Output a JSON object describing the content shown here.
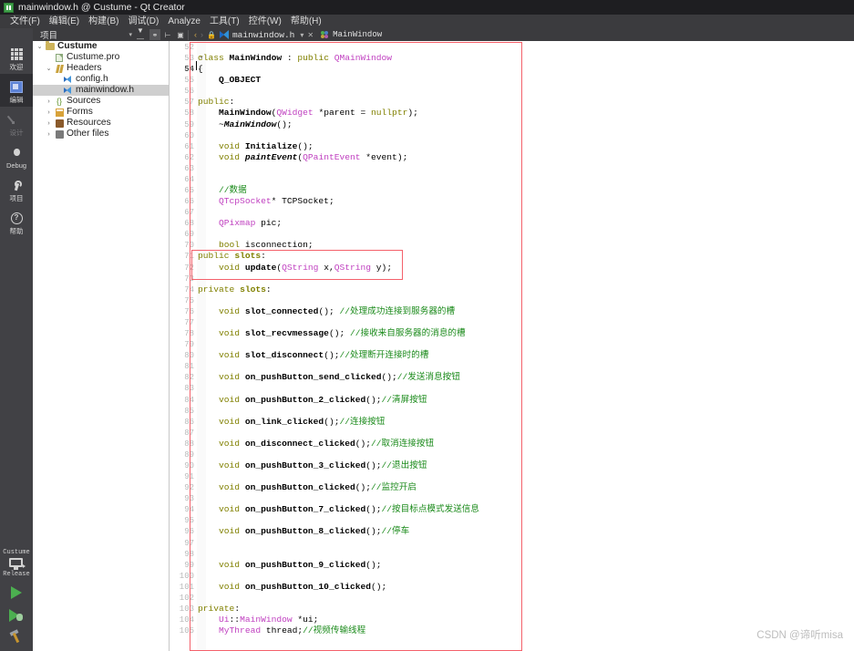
{
  "window": {
    "title": "mainwindow.h @ Custume - Qt Creator",
    "app_icon": "qt-creator-icon"
  },
  "menubar": {
    "items": [
      {
        "label": "文件(F)",
        "name": "menu-file"
      },
      {
        "label": "编辑(E)",
        "name": "menu-edit"
      },
      {
        "label": "构建(B)",
        "name": "menu-build"
      },
      {
        "label": "调试(D)",
        "name": "menu-debug"
      },
      {
        "label": "Analyze",
        "name": "menu-analyze"
      },
      {
        "label": "工具(T)",
        "name": "menu-tools"
      },
      {
        "label": "控件(W)",
        "name": "menu-window"
      },
      {
        "label": "帮助(H)",
        "name": "menu-help"
      }
    ]
  },
  "toolbar": {
    "tree_selector": "项目",
    "tree_selector_caret": "▾",
    "filter_icon": "filter-icon",
    "sync_icon": "link-sync-icon",
    "expand_icon": "expand-all-icon",
    "split_icon": "split-view-icon",
    "nav_back": "‹",
    "nav_forward": "›",
    "lock_icon": "lock-icon",
    "document_name": "mainwindow.h",
    "document_caret": "▾",
    "document_close": "✕",
    "symbol_name": "MainWindow"
  },
  "modebar": {
    "items": [
      {
        "label": "欢迎",
        "icon": "welcome-grid-icon",
        "state": "normal",
        "name": "mode-welcome"
      },
      {
        "label": "编辑",
        "icon": "edit-icon",
        "state": "selected",
        "name": "mode-edit"
      },
      {
        "label": "设计",
        "icon": "design-pencil-icon",
        "state": "disabled",
        "name": "mode-design"
      },
      {
        "label": "Debug",
        "icon": "debug-bug-icon",
        "state": "normal",
        "name": "mode-debug"
      },
      {
        "label": "项目",
        "icon": "projects-wrench-icon",
        "state": "normal",
        "name": "mode-projects"
      },
      {
        "label": "帮助",
        "icon": "help-question-icon",
        "state": "normal",
        "name": "mode-help"
      }
    ],
    "kit_name": "Custume",
    "build_config": "Release",
    "run_icon": "run-triangle-icon",
    "debug_icon": "debug-run-icon",
    "build_icon": "build-hammer-icon"
  },
  "project_tree": {
    "rows": [
      {
        "label": "Custume",
        "indent": 0,
        "twisty": "⌄",
        "icon": "folder-icon",
        "bold": true,
        "selected": false
      },
      {
        "label": "Custume.pro",
        "indent": 1,
        "twisty": "",
        "icon": "pro-file-icon",
        "bold": false,
        "selected": false
      },
      {
        "label": "Headers",
        "indent": 1,
        "twisty": "⌄",
        "icon": "headers-icon",
        "bold": false,
        "selected": false
      },
      {
        "label": "config.h",
        "indent": 2,
        "twisty": "",
        "icon": "header-file-icon",
        "bold": false,
        "selected": false
      },
      {
        "label": "mainwindow.h",
        "indent": 2,
        "twisty": "",
        "icon": "header-file-icon",
        "bold": false,
        "selected": true
      },
      {
        "label": "Sources",
        "indent": 1,
        "twisty": "›",
        "icon": "sources-icon",
        "bold": false,
        "selected": false
      },
      {
        "label": "Forms",
        "indent": 1,
        "twisty": "›",
        "icon": "forms-icon",
        "bold": false,
        "selected": false
      },
      {
        "label": "Resources",
        "indent": 1,
        "twisty": "›",
        "icon": "resources-icon",
        "bold": false,
        "selected": false
      },
      {
        "label": "Other files",
        "indent": 1,
        "twisty": "›",
        "icon": "other-files-icon",
        "bold": false,
        "selected": false
      }
    ]
  },
  "editor": {
    "first_line_number": 52,
    "current_line_number": 54,
    "total_visible_lines": 54,
    "lines": [
      {
        "n": 52,
        "fold": "",
        "tokens": []
      },
      {
        "n": 53,
        "fold": "▾",
        "tokens": [
          {
            "t": "class ",
            "c": "k"
          },
          {
            "t": "MainWindow",
            "c": "fn"
          },
          {
            "t": " : ",
            "c": "pl"
          },
          {
            "t": "public",
            "c": "k"
          },
          {
            "t": " ",
            "c": "pl"
          },
          {
            "t": "QMainWindow",
            "c": "ty"
          }
        ]
      },
      {
        "n": 54,
        "fold": "·",
        "tokens": [
          {
            "t": "{",
            "c": "pl"
          }
        ]
      },
      {
        "n": 55,
        "fold": "",
        "tokens": [
          {
            "t": "    Q_OBJECT",
            "c": "mac"
          }
        ]
      },
      {
        "n": 56,
        "fold": "",
        "tokens": []
      },
      {
        "n": 57,
        "fold": "",
        "tokens": [
          {
            "t": "public",
            "c": "k"
          },
          {
            "t": ":",
            "c": "pl"
          }
        ]
      },
      {
        "n": 58,
        "fold": "",
        "tokens": [
          {
            "t": "    ",
            "c": "pl"
          },
          {
            "t": "MainWindow",
            "c": "fn"
          },
          {
            "t": "(",
            "c": "pl"
          },
          {
            "t": "QWidget",
            "c": "ty"
          },
          {
            "t": " *parent = ",
            "c": "pl"
          },
          {
            "t": "nullptr",
            "c": "k"
          },
          {
            "t": ");",
            "c": "pl"
          }
        ]
      },
      {
        "n": 59,
        "fold": "",
        "tokens": [
          {
            "t": "    ~",
            "c": "pl"
          },
          {
            "t": "MainWindow",
            "c": "fi"
          },
          {
            "t": "();",
            "c": "pl"
          }
        ]
      },
      {
        "n": 60,
        "fold": "",
        "tokens": []
      },
      {
        "n": 61,
        "fold": "",
        "tokens": [
          {
            "t": "    ",
            "c": "pl"
          },
          {
            "t": "void",
            "c": "k"
          },
          {
            "t": " ",
            "c": "pl"
          },
          {
            "t": "Initialize",
            "c": "fn"
          },
          {
            "t": "();",
            "c": "pl"
          }
        ]
      },
      {
        "n": 62,
        "fold": "",
        "tokens": [
          {
            "t": "    ",
            "c": "pl"
          },
          {
            "t": "void",
            "c": "k"
          },
          {
            "t": " ",
            "c": "pl"
          },
          {
            "t": "paintEvent",
            "c": "fi"
          },
          {
            "t": "(",
            "c": "pl"
          },
          {
            "t": "QPaintEvent",
            "c": "ty"
          },
          {
            "t": " *event);",
            "c": "pl"
          }
        ]
      },
      {
        "n": 63,
        "fold": "",
        "tokens": []
      },
      {
        "n": 64,
        "fold": "",
        "tokens": []
      },
      {
        "n": 65,
        "fold": "",
        "tokens": [
          {
            "t": "    //数据",
            "c": "cm"
          }
        ]
      },
      {
        "n": 66,
        "fold": "",
        "tokens": [
          {
            "t": "    ",
            "c": "pl"
          },
          {
            "t": "QTcpSocket",
            "c": "ty"
          },
          {
            "t": "* TCPSocket;",
            "c": "pl"
          }
        ]
      },
      {
        "n": 67,
        "fold": "",
        "tokens": []
      },
      {
        "n": 68,
        "fold": "",
        "tokens": [
          {
            "t": "    ",
            "c": "pl"
          },
          {
            "t": "QPixmap",
            "c": "ty"
          },
          {
            "t": " pic;",
            "c": "pl"
          }
        ]
      },
      {
        "n": 69,
        "fold": "",
        "tokens": []
      },
      {
        "n": 70,
        "fold": "",
        "tokens": [
          {
            "t": "    ",
            "c": "pl"
          },
          {
            "t": "bool",
            "c": "k"
          },
          {
            "t": " isconnection;",
            "c": "pl"
          }
        ]
      },
      {
        "n": 71,
        "fold": "",
        "tokens": [
          {
            "t": "public",
            "c": "k"
          },
          {
            "t": " ",
            "c": "pl"
          },
          {
            "t": "slots",
            "c": "kb"
          },
          {
            "t": ":",
            "c": "pl"
          }
        ]
      },
      {
        "n": 72,
        "fold": "",
        "tokens": [
          {
            "t": "    ",
            "c": "pl"
          },
          {
            "t": "void",
            "c": "k"
          },
          {
            "t": " ",
            "c": "pl"
          },
          {
            "t": "update",
            "c": "fn"
          },
          {
            "t": "(",
            "c": "pl"
          },
          {
            "t": "QString",
            "c": "ty"
          },
          {
            "t": " x,",
            "c": "pl"
          },
          {
            "t": "QString",
            "c": "ty"
          },
          {
            "t": " y);",
            "c": "pl"
          }
        ]
      },
      {
        "n": 73,
        "fold": "",
        "tokens": []
      },
      {
        "n": 74,
        "fold": "",
        "tokens": [
          {
            "t": "private",
            "c": "k"
          },
          {
            "t": " ",
            "c": "pl"
          },
          {
            "t": "slots",
            "c": "kb"
          },
          {
            "t": ":",
            "c": "pl"
          }
        ]
      },
      {
        "n": 75,
        "fold": "",
        "tokens": []
      },
      {
        "n": 76,
        "fold": "",
        "tokens": [
          {
            "t": "    ",
            "c": "pl"
          },
          {
            "t": "void",
            "c": "k"
          },
          {
            "t": " ",
            "c": "pl"
          },
          {
            "t": "slot_connected",
            "c": "fn"
          },
          {
            "t": "(); ",
            "c": "pl"
          },
          {
            "t": "//处理成功连接到服务器的槽",
            "c": "cm"
          }
        ]
      },
      {
        "n": 77,
        "fold": "",
        "tokens": []
      },
      {
        "n": 78,
        "fold": "",
        "tokens": [
          {
            "t": "    ",
            "c": "pl"
          },
          {
            "t": "void",
            "c": "k"
          },
          {
            "t": " ",
            "c": "pl"
          },
          {
            "t": "slot_recvmessage",
            "c": "fn"
          },
          {
            "t": "(); ",
            "c": "pl"
          },
          {
            "t": "//接收来自服务器的消息的槽",
            "c": "cm"
          }
        ]
      },
      {
        "n": 79,
        "fold": "",
        "tokens": []
      },
      {
        "n": 80,
        "fold": "",
        "tokens": [
          {
            "t": "    ",
            "c": "pl"
          },
          {
            "t": "void",
            "c": "k"
          },
          {
            "t": " ",
            "c": "pl"
          },
          {
            "t": "slot_disconnect",
            "c": "fn"
          },
          {
            "t": "();",
            "c": "pl"
          },
          {
            "t": "//处理断开连接时的槽",
            "c": "cm"
          }
        ]
      },
      {
        "n": 81,
        "fold": "",
        "tokens": []
      },
      {
        "n": 82,
        "fold": "",
        "tokens": [
          {
            "t": "    ",
            "c": "pl"
          },
          {
            "t": "void",
            "c": "k"
          },
          {
            "t": " ",
            "c": "pl"
          },
          {
            "t": "on_pushButton_send_clicked",
            "c": "fn"
          },
          {
            "t": "();",
            "c": "pl"
          },
          {
            "t": "//发送消息按钮",
            "c": "cm"
          }
        ]
      },
      {
        "n": 83,
        "fold": "",
        "tokens": []
      },
      {
        "n": 84,
        "fold": "",
        "tokens": [
          {
            "t": "    ",
            "c": "pl"
          },
          {
            "t": "void",
            "c": "k"
          },
          {
            "t": " ",
            "c": "pl"
          },
          {
            "t": "on_pushButton_2_clicked",
            "c": "fn"
          },
          {
            "t": "();",
            "c": "pl"
          },
          {
            "t": "//清屏按钮",
            "c": "cm"
          }
        ]
      },
      {
        "n": 85,
        "fold": "",
        "tokens": []
      },
      {
        "n": 86,
        "fold": "",
        "tokens": [
          {
            "t": "    ",
            "c": "pl"
          },
          {
            "t": "void",
            "c": "k"
          },
          {
            "t": " ",
            "c": "pl"
          },
          {
            "t": "on_link_clicked",
            "c": "fn"
          },
          {
            "t": "();",
            "c": "pl"
          },
          {
            "t": "//连接按钮",
            "c": "cm"
          }
        ]
      },
      {
        "n": 87,
        "fold": "",
        "tokens": []
      },
      {
        "n": 88,
        "fold": "",
        "tokens": [
          {
            "t": "    ",
            "c": "pl"
          },
          {
            "t": "void",
            "c": "k"
          },
          {
            "t": " ",
            "c": "pl"
          },
          {
            "t": "on_disconnect_clicked",
            "c": "fn"
          },
          {
            "t": "();",
            "c": "pl"
          },
          {
            "t": "//取消连接按钮",
            "c": "cm"
          }
        ]
      },
      {
        "n": 89,
        "fold": "",
        "tokens": []
      },
      {
        "n": 90,
        "fold": "",
        "tokens": [
          {
            "t": "    ",
            "c": "pl"
          },
          {
            "t": "void",
            "c": "k"
          },
          {
            "t": " ",
            "c": "pl"
          },
          {
            "t": "on_pushButton_3_clicked",
            "c": "fn"
          },
          {
            "t": "();",
            "c": "pl"
          },
          {
            "t": "//退出按钮",
            "c": "cm"
          }
        ]
      },
      {
        "n": 91,
        "fold": "",
        "tokens": []
      },
      {
        "n": 92,
        "fold": "",
        "tokens": [
          {
            "t": "    ",
            "c": "pl"
          },
          {
            "t": "void",
            "c": "k"
          },
          {
            "t": " ",
            "c": "pl"
          },
          {
            "t": "on_pushButton_clicked",
            "c": "fn"
          },
          {
            "t": "();",
            "c": "pl"
          },
          {
            "t": "//监控开启",
            "c": "cm"
          }
        ]
      },
      {
        "n": 93,
        "fold": "",
        "tokens": []
      },
      {
        "n": 94,
        "fold": "",
        "tokens": [
          {
            "t": "    ",
            "c": "pl"
          },
          {
            "t": "void",
            "c": "k"
          },
          {
            "t": " ",
            "c": "pl"
          },
          {
            "t": "on_pushButton_7_clicked",
            "c": "fn"
          },
          {
            "t": "();",
            "c": "pl"
          },
          {
            "t": "//按目标点模式发送信息",
            "c": "cm"
          }
        ]
      },
      {
        "n": 95,
        "fold": "",
        "tokens": []
      },
      {
        "n": 96,
        "fold": "",
        "tokens": [
          {
            "t": "    ",
            "c": "pl"
          },
          {
            "t": "void",
            "c": "k"
          },
          {
            "t": " ",
            "c": "pl"
          },
          {
            "t": "on_pushButton_8_clicked",
            "c": "fn"
          },
          {
            "t": "();",
            "c": "pl"
          },
          {
            "t": "//停车",
            "c": "cm"
          }
        ]
      },
      {
        "n": 97,
        "fold": "",
        "tokens": []
      },
      {
        "n": 98,
        "fold": "",
        "tokens": []
      },
      {
        "n": 99,
        "fold": "",
        "tokens": [
          {
            "t": "    ",
            "c": "pl"
          },
          {
            "t": "void",
            "c": "k"
          },
          {
            "t": " ",
            "c": "pl"
          },
          {
            "t": "on_pushButton_9_clicked",
            "c": "fn"
          },
          {
            "t": "();",
            "c": "pl"
          }
        ]
      },
      {
        "n": 100,
        "fold": "",
        "tokens": []
      },
      {
        "n": 101,
        "fold": "",
        "tokens": [
          {
            "t": "    ",
            "c": "pl"
          },
          {
            "t": "void",
            "c": "k"
          },
          {
            "t": " ",
            "c": "pl"
          },
          {
            "t": "on_pushButton_10_clicked",
            "c": "fn"
          },
          {
            "t": "();",
            "c": "pl"
          }
        ]
      },
      {
        "n": 102,
        "fold": "",
        "tokens": []
      },
      {
        "n": 103,
        "fold": "",
        "tokens": [
          {
            "t": "private",
            "c": "k"
          },
          {
            "t": ":",
            "c": "pl"
          }
        ]
      },
      {
        "n": 104,
        "fold": "",
        "tokens": [
          {
            "t": "    ",
            "c": "pl"
          },
          {
            "t": "Ui",
            "c": "ty"
          },
          {
            "t": "::",
            "c": "pl"
          },
          {
            "t": "MainWindow",
            "c": "ty"
          },
          {
            "t": " *ui;",
            "c": "pl"
          }
        ]
      },
      {
        "n": 105,
        "fold": "",
        "tokens": [
          {
            "t": "    ",
            "c": "pl"
          },
          {
            "t": "MyThread",
            "c": "ty"
          },
          {
            "t": " thread;",
            "c": "pl"
          },
          {
            "t": "//视频传输线程",
            "c": "cm"
          }
        ]
      }
    ]
  },
  "annotations": {
    "outer_box_color": "#f4616b",
    "inner_box_color": "#f4616b",
    "inner_box_target": "public slots: void update(QString x,QString y);"
  },
  "watermark": {
    "text": "CSDN @谛听misa"
  }
}
